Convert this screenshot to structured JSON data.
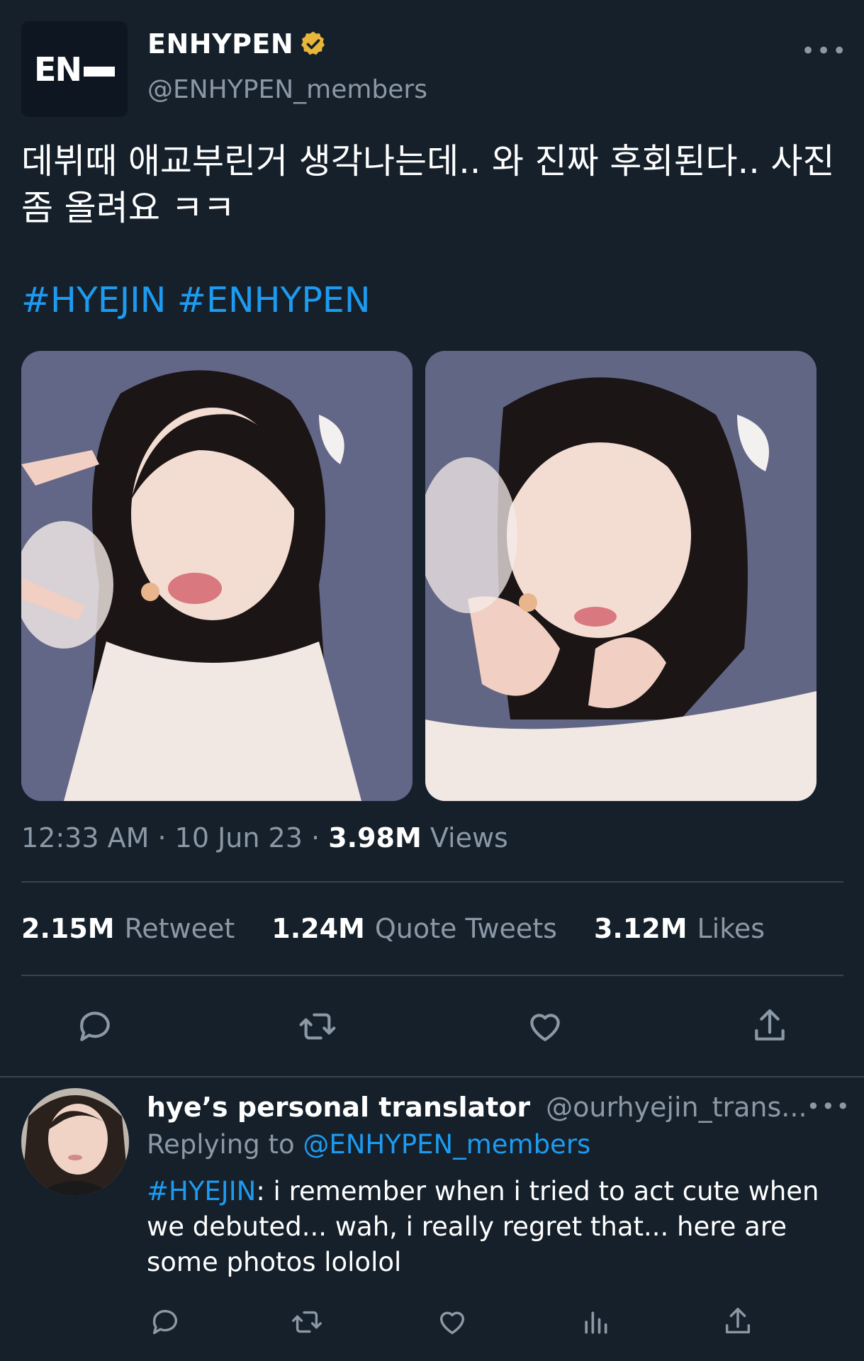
{
  "tweet": {
    "display_name": "ENHYPEN",
    "handle": "@ENHYPEN_members",
    "logo_text": "EN",
    "more": "•••",
    "text": "데뷔때 애교부린거 생각나는데.. 와 진짜 후회된다.. 사진 좀 올려요 ㅋㅋ",
    "hashtags": "#HYEJIN #ENHYPEN",
    "time": "12:33 AM",
    "date": "10 Jun 23",
    "dot": "·",
    "views_count": "3.98M",
    "views_label": "Views",
    "stats": [
      {
        "count": "2.15M",
        "label": "Retweet"
      },
      {
        "count": "1.24M",
        "label": "Quote Tweets"
      },
      {
        "count": "3.12M",
        "label": "Likes"
      }
    ],
    "actions": [
      "reply-icon",
      "retweet-icon",
      "like-icon",
      "share-icon"
    ]
  },
  "reply": {
    "display_name": "hye’s personal translator",
    "handle": "@ourhyejin_trans...",
    "more": "•••",
    "replying_prefix": "Replying to",
    "replying_to": "@ENHYPEN_members",
    "hashtag": "#HYEJIN",
    "text": ": i remember when i tried to act cute when we debuted... wah, i really regret that... here are some photos lololol",
    "actions": [
      "reply-icon",
      "retweet-icon",
      "like-icon",
      "analytics-icon",
      "share-icon"
    ]
  },
  "colors": {
    "background": "#15202b",
    "link": "#1d9bf0",
    "muted": "#8b98a5",
    "verified_badge": "#e8b63a",
    "divider": "#38444d"
  }
}
